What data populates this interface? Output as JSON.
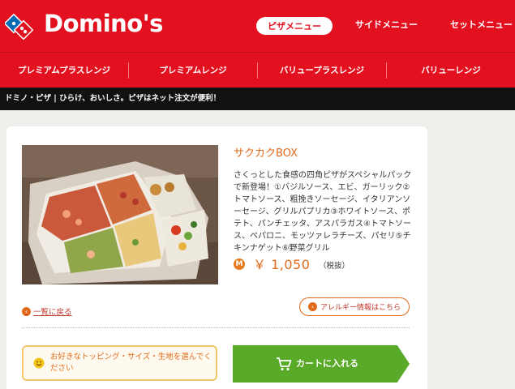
{
  "header": {
    "logo_text": "Domino's",
    "nav": [
      "ピザメニュー",
      "サイドメニュー",
      "セットメニュー"
    ]
  },
  "subnav": {
    "items": [
      "プレミアムプラスレンジ",
      "プレミアムレンジ",
      "バリュープラスレンジ",
      "バリューレンジ"
    ]
  },
  "tagline": "ドミノ・ピザ | ひらけ、おいしさ。ピザはネット注文が便利！",
  "product": {
    "name": "サクカクBOX",
    "description": "さくっとした食感の四角ピザがスペシャルパックで新登場！①バジルソース、エビ、ガーリック②トマトソース、粗挽きソーセージ、イタリアンソーセージ、グリルパプリカ③ホワイトソース、ポテト、パンチェッタ、アスパラガス④トマトソース、ペパロニ、モッツァレラチーズ、パセリ⑤チキンナゲット⑥野菜グリル",
    "size_badge": "M",
    "price": "￥ 1,050",
    "tax_note": "（税抜）"
  },
  "links": {
    "back": "一覧に戻る",
    "allergy": "アレルギー情報はこちら"
  },
  "hint": "お好きなトッピング・サイズ・生地を選んでください",
  "cart_button": "カートに入れる",
  "colors": {
    "brand_red": "#e3101f",
    "accent_orange": "#e06a1a",
    "cart_green": "#5aaa2a"
  }
}
